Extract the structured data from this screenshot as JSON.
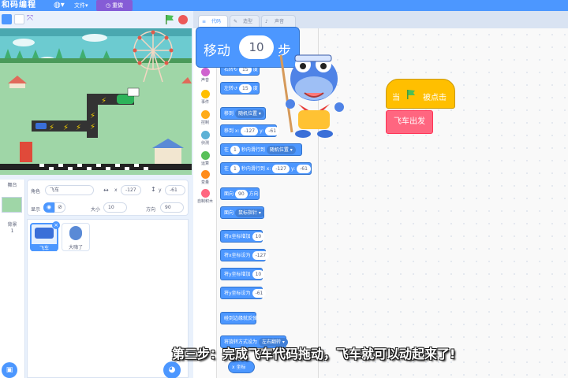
{
  "menubar": {
    "logo": "和码编程",
    "file_menu": "文件▾",
    "remix": "重做"
  },
  "editor_tabs": [
    {
      "label": "代码"
    },
    {
      "label": "造型"
    },
    {
      "label": "声音"
    }
  ],
  "categories": [
    {
      "label": "声音",
      "color": "#cf63cf"
    },
    {
      "label": "事件",
      "color": "#ffbf00"
    },
    {
      "label": "控制",
      "color": "#ffab19"
    },
    {
      "label": "侦测",
      "color": "#5cb1d6"
    },
    {
      "label": "运算",
      "color": "#59c059"
    },
    {
      "label": "变量",
      "color": "#ff8c1a"
    },
    {
      "label": "自制积木",
      "color": "#ff6680"
    }
  ],
  "palette": {
    "turn_right": {
      "pre": "右转",
      "val": "15",
      "post": "度"
    },
    "turn_left": {
      "pre": "左转",
      "val": "15",
      "post": "度"
    },
    "goto_random": {
      "pre": "移到",
      "val": "随机位置 ▾"
    },
    "goto_xy": {
      "pre": "移到 x:",
      "x": "-127",
      "mid": "y:",
      "y": "-61"
    },
    "glide_random": {
      "pre": "在",
      "val": "1",
      "mid": "秒内滑行到",
      "target": "随机位置 ▾"
    },
    "glide_xy": {
      "pre": "在",
      "val": "1",
      "mid": "秒内滑行到 x:",
      "x": "-127",
      "mid2": "y:",
      "y": "-61"
    },
    "point_dir": {
      "pre": "面向",
      "val": "90",
      "post": "方向"
    },
    "point_towards": {
      "pre": "面向",
      "val": "鼠标指针 ▾"
    },
    "change_x": {
      "pre": "将x坐标增加",
      "val": "10"
    },
    "set_x": {
      "pre": "将x坐标设为",
      "val": "-127"
    },
    "change_y": {
      "pre": "将y坐标增加",
      "val": "10"
    },
    "set_y": {
      "pre": "将y坐标设为",
      "val": "-61"
    },
    "bounce": {
      "label": "碰到边缘就反弹"
    },
    "rotation_style": {
      "pre": "将旋转方式设为",
      "val": "左右翻转 ▾"
    },
    "x_pos": {
      "label": "x 坐标"
    }
  },
  "big_block": {
    "move": "移动",
    "value": "10",
    "steps": "步"
  },
  "scripts": {
    "hat_when": "当",
    "hat_clicked": "被点击",
    "fly": "飞车出发"
  },
  "sprite_info": {
    "sprite_label": "角色",
    "sprite_name": "飞车",
    "x_label": "x",
    "x_value": "-127",
    "y_label": "y",
    "y_value": "-61",
    "show_label": "显示",
    "size_label": "大小",
    "size_value": "10",
    "direction_label": "方向",
    "direction_value": "90"
  },
  "stage_pane": {
    "title": "舞台",
    "backdrop_label": "背景",
    "backdrop_count": "1"
  },
  "sprites": [
    {
      "name": "飞车",
      "selected": true
    },
    {
      "name": "大嗨了",
      "selected": false
    }
  ],
  "subtitle": "第三步：完成飞车代码拖动，飞车就可以动起来了!",
  "colors": {
    "accent": "#4c97ff",
    "event": "#ffbf00",
    "custom": "#ff6680",
    "remix": "#855cd6"
  }
}
